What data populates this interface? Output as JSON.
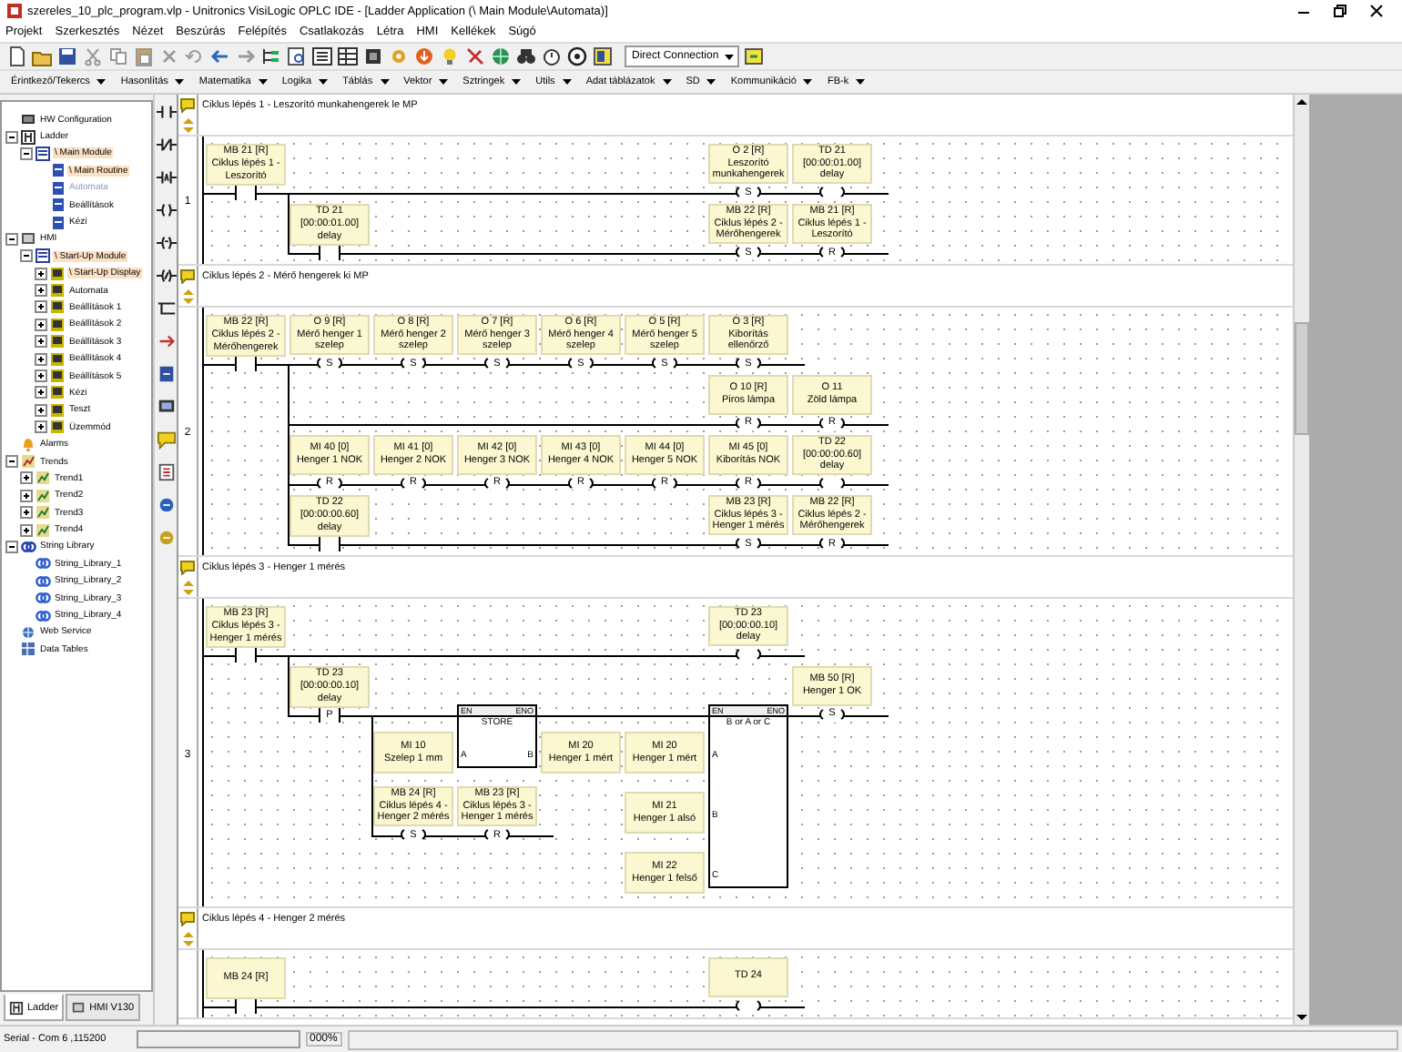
{
  "window": {
    "title": "szereles_10_plc_program.vlp - Unitronics VisiLogic OPLC IDE - [Ladder Application (\\ Main Module\\Automata)]"
  },
  "menu": [
    "Projekt",
    "Szerkesztés",
    "Nézet",
    "Beszúrás",
    "Felépítés",
    "Csatlakozás",
    "Létra",
    "HMI",
    "Kellékek",
    "Súgó"
  ],
  "connection": {
    "value": "Direct Connection"
  },
  "element_menus": [
    "Érintkező/Tekercs",
    "Hasonlítás",
    "Matematika",
    "Logika",
    "Táblás",
    "Vektor",
    "Sztringek",
    "Utils",
    "Adat táblázatok",
    "SD",
    "Kommunikáció",
    "FB-k"
  ],
  "tree": [
    {
      "label": "HW Configuration",
      "kind": "hardware",
      "selected": false,
      "dimmed": false
    },
    {
      "label": "Ladder",
      "kind": "ladder",
      "expanded": true,
      "selected": false,
      "dimmed": false,
      "children": [
        {
          "label": "\\ Main Module",
          "kind": "module",
          "expanded": true,
          "selected": true,
          "dimmed": false,
          "children": [
            {
              "label": "\\ Main Routine",
              "kind": "routine",
              "selected": true,
              "dimmed": false
            },
            {
              "label": "Automata",
              "kind": "routine",
              "selected": false,
              "dimmed": true
            },
            {
              "label": "Beállítások",
              "kind": "routine",
              "selected": false,
              "dimmed": false
            },
            {
              "label": "Kézi",
              "kind": "routine",
              "selected": false,
              "dimmed": false
            }
          ]
        }
      ]
    },
    {
      "label": "HMI",
      "kind": "hmi",
      "expanded": true,
      "selected": false,
      "dimmed": false,
      "children": [
        {
          "label": "\\ Start-Up Module",
          "kind": "module",
          "expanded": true,
          "selected": true,
          "dimmed": false,
          "children": [
            {
              "label": "\\ Start-Up Display",
              "kind": "display",
              "expanded": false,
              "selected": true,
              "dimmed": false
            },
            {
              "label": "Automata",
              "kind": "display",
              "expanded": false,
              "selected": false,
              "dimmed": false
            },
            {
              "label": "Beállítások 1",
              "kind": "display",
              "expanded": false,
              "selected": false,
              "dimmed": false
            },
            {
              "label": "Beállítások 2",
              "kind": "display",
              "expanded": false,
              "selected": false,
              "dimmed": false
            },
            {
              "label": "Beállítások 3",
              "kind": "display",
              "expanded": false,
              "selected": false,
              "dimmed": false
            },
            {
              "label": "Beállítások 4",
              "kind": "display",
              "expanded": false,
              "selected": false,
              "dimmed": false
            },
            {
              "label": "Beállítások 5",
              "kind": "display",
              "expanded": false,
              "selected": false,
              "dimmed": false
            },
            {
              "label": "Kézi",
              "kind": "display",
              "expanded": false,
              "selected": false,
              "dimmed": false
            },
            {
              "label": "Teszt",
              "kind": "display",
              "expanded": false,
              "selected": false,
              "dimmed": false
            },
            {
              "label": "Üzemmód",
              "kind": "display",
              "expanded": false,
              "selected": false,
              "dimmed": false
            }
          ]
        }
      ]
    },
    {
      "label": "Alarms",
      "kind": "alarm",
      "selected": false,
      "dimmed": false
    },
    {
      "label": "Trends",
      "kind": "trends",
      "expanded": true,
      "selected": false,
      "dimmed": false,
      "children": [
        {
          "label": "Trend1",
          "kind": "trend",
          "expanded": false,
          "selected": false,
          "dimmed": false
        },
        {
          "label": "Trend2",
          "kind": "trend",
          "expanded": false,
          "selected": false,
          "dimmed": false
        },
        {
          "label": "Trend3",
          "kind": "trend",
          "expanded": false,
          "selected": false,
          "dimmed": false
        },
        {
          "label": "Trend4",
          "kind": "trend",
          "expanded": false,
          "selected": false,
          "dimmed": false
        }
      ]
    },
    {
      "label": "String Library",
      "kind": "library",
      "expanded": true,
      "selected": false,
      "dimmed": false,
      "children": [
        {
          "label": "String_Library_1",
          "kind": "string",
          "selected": false,
          "dimmed": false
        },
        {
          "label": "String_Library_2",
          "kind": "string",
          "selected": false,
          "dimmed": false
        },
        {
          "label": "String_Library_3",
          "kind": "string",
          "selected": false,
          "dimmed": false
        },
        {
          "label": "String_Library_4",
          "kind": "string",
          "selected": false,
          "dimmed": false
        }
      ]
    },
    {
      "label": "Web Service",
      "kind": "web",
      "selected": false,
      "dimmed": false
    },
    {
      "label": "Data Tables",
      "kind": "data",
      "selected": false,
      "dimmed": false
    }
  ],
  "panel_tabs": [
    {
      "label": "Ladder",
      "kind": "ladder",
      "selected": true
    },
    {
      "label": "HMI V130",
      "kind": "hmi",
      "selected": false
    }
  ],
  "nets": [
    {
      "number": "1",
      "comment": "Ciklus lépés 1 - Leszorító munkahengerek le MP",
      "rows": [
        [
          {
            "kind": "contact",
            "text": [
              "MB 21 [R]",
              "Ciklus lépés 1 -",
              "Leszorító"
            ]
          },
          null,
          null,
          null,
          null,
          null,
          {
            "kind": "coil",
            "mode": "S",
            "text": [
              "O 2 [R]",
              "Leszorító",
              "munkahengerek"
            ]
          },
          {
            "kind": "coil",
            "text": [
              "TD 21",
              "[00:00:01.00]",
              "delay"
            ]
          }
        ],
        [
          null,
          {
            "kind": "contact",
            "text": [
              "TD 21",
              "[00:00:01.00]",
              "delay"
            ]
          },
          null,
          null,
          null,
          null,
          {
            "kind": "coil",
            "mode": "S",
            "text": [
              "MB 22 [R]",
              "Ciklus lépés 2 -",
              "Mérőhengerek"
            ]
          },
          {
            "kind": "coil",
            "mode": "R",
            "text": [
              "MB 21 [R]",
              "Ciklus lépés 1 -",
              "Leszorító"
            ]
          }
        ]
      ]
    },
    {
      "number": "2",
      "comment": "Ciklus lépés 2 - Mérő hengerek ki MP",
      "rows": [
        [
          {
            "kind": "contact",
            "text": [
              "MB 22 [R]",
              "Ciklus lépés 2 -",
              "Mérőhengerek"
            ]
          },
          {
            "kind": "coil",
            "mode": "S",
            "text": [
              "O 9 [R]",
              "Mérő henger 1",
              "szelep"
            ]
          },
          {
            "kind": "coil",
            "mode": "S",
            "text": [
              "O 8 [R]",
              "Mérő henger 2",
              "szelep"
            ]
          },
          {
            "kind": "coil",
            "mode": "S",
            "text": [
              "O 7 [R]",
              "Mérő henger 3",
              "szelep"
            ]
          },
          {
            "kind": "coil",
            "mode": "S",
            "text": [
              "O 6 [R]",
              "Mérő henger 4",
              "szelep"
            ]
          },
          {
            "kind": "coil",
            "mode": "S",
            "text": [
              "O 5 [R]",
              "Mérő henger 5",
              "szelep"
            ]
          },
          {
            "kind": "coil",
            "mode": "S",
            "text": [
              "O 3 [R]",
              "Kiborítás",
              "ellenőrző"
            ]
          }
        ],
        [
          null,
          null,
          null,
          null,
          null,
          null,
          {
            "kind": "coil",
            "mode": "R",
            "text": [
              "O 10 [R]",
              "Piros lámpa"
            ]
          },
          {
            "kind": "coil",
            "mode": "R",
            "text": [
              "O 11",
              "Zöld lámpa"
            ]
          }
        ],
        [
          null,
          {
            "kind": "coil",
            "mode": "R",
            "text": [
              "MI 40 [0]",
              "Henger 1 NOK"
            ]
          },
          {
            "kind": "coil",
            "mode": "R",
            "text": [
              "MI 41 [0]",
              "Henger 2 NOK"
            ]
          },
          {
            "kind": "coil",
            "mode": "R",
            "text": [
              "MI 42 [0]",
              "Henger 3 NOK"
            ]
          },
          {
            "kind": "coil",
            "mode": "R",
            "text": [
              "MI 43 [0]",
              "Henger 4 NOK"
            ]
          },
          {
            "kind": "coil",
            "mode": "R",
            "text": [
              "MI 44 [0]",
              "Henger 5 NOK"
            ]
          },
          {
            "kind": "coil",
            "mode": "R",
            "text": [
              "MI 45 [0]",
              "Kiborítás NOK"
            ]
          },
          {
            "kind": "coil",
            "text": [
              "TD 22",
              "[00:00:00.60]",
              "delay"
            ]
          }
        ],
        [
          null,
          {
            "kind": "contact",
            "text": [
              "TD 22",
              "[00:00:00.60]",
              "delay"
            ]
          },
          null,
          null,
          null,
          null,
          {
            "kind": "coil",
            "mode": "S",
            "text": [
              "MB 23 [R]",
              "Ciklus lépés 3 -",
              "Henger 1 mérés"
            ]
          },
          {
            "kind": "coil",
            "mode": "R",
            "text": [
              "MB 22 [R]",
              "Ciklus lépés 2 -",
              "Mérőhengerek"
            ]
          }
        ]
      ]
    },
    {
      "number": "3",
      "comment": "Ciklus lépés 3 - Henger 1 mérés",
      "rows": [
        [
          {
            "kind": "contact",
            "text": [
              "MB 23 [R]",
              "Ciklus lépés 3 -",
              "Henger 1 mérés"
            ]
          },
          null,
          null,
          null,
          null,
          null,
          {
            "kind": "coil",
            "text": [
              "TD 23",
              "[00:00:00.10]",
              "delay"
            ]
          }
        ],
        [
          null,
          {
            "kind": "contact",
            "mode": "P",
            "text": [
              "TD 23",
              "[00:00:00.10]",
              "delay"
            ]
          },
          null,
          {
            "kind": "block",
            "enable": "EN",
            "enable_out": "ENO",
            "title": "STORE",
            "inputs": [
              "A"
            ],
            "outputs": [
              "B"
            ]
          },
          null,
          null,
          {
            "kind": "block",
            "enable": "EN",
            "enable_out": "ENO",
            "title": "B or A or C",
            "inputs": [
              "A",
              "B",
              "C"
            ]
          },
          {
            "kind": "coil",
            "mode": "S",
            "text": [
              "MB 50 [R]",
              "Henger 1 OK"
            ]
          }
        ],
        [
          null,
          null,
          {
            "kind": "operand",
            "text": [
              "MI 10",
              "Szelep 1 mm"
            ]
          },
          null,
          {
            "kind": "operand",
            "text": [
              "MI 20",
              "Henger 1 mért"
            ]
          },
          {
            "kind": "operand",
            "text": [
              "MI 20",
              "Henger 1 mért"
            ]
          }
        ],
        [
          null,
          null,
          {
            "kind": "coil",
            "mode": "S",
            "text": [
              "MB 24 [R]",
              "Ciklus lépés 4 -",
              "Henger 2 mérés"
            ]
          },
          {
            "kind": "coil",
            "mode": "R",
            "text": [
              "MB 23 [R]",
              "Ciklus lépés 3 -",
              "Henger 1 mérés"
            ]
          },
          null,
          {
            "kind": "operand",
            "text": [
              "MI 21",
              "Henger 1 alsó"
            ]
          }
        ],
        [
          null,
          null,
          null,
          null,
          null,
          {
            "kind": "operand",
            "text": [
              "MI 22",
              "Henger 1 felső"
            ]
          }
        ]
      ]
    },
    {
      "comment": "Ciklus lépés 4 - Henger 2 mérés",
      "rows": [
        [
          {
            "kind": "contact",
            "text": [
              "MB 24 [R]"
            ]
          },
          null,
          null,
          null,
          null,
          null,
          {
            "kind": "coil",
            "text": [
              "TD 24"
            ]
          }
        ]
      ]
    }
  ],
  "status_bar": {
    "connection": "Serial - Com 6 ,115200",
    "progress": {
      "level": 0,
      "label": "000%"
    }
  }
}
